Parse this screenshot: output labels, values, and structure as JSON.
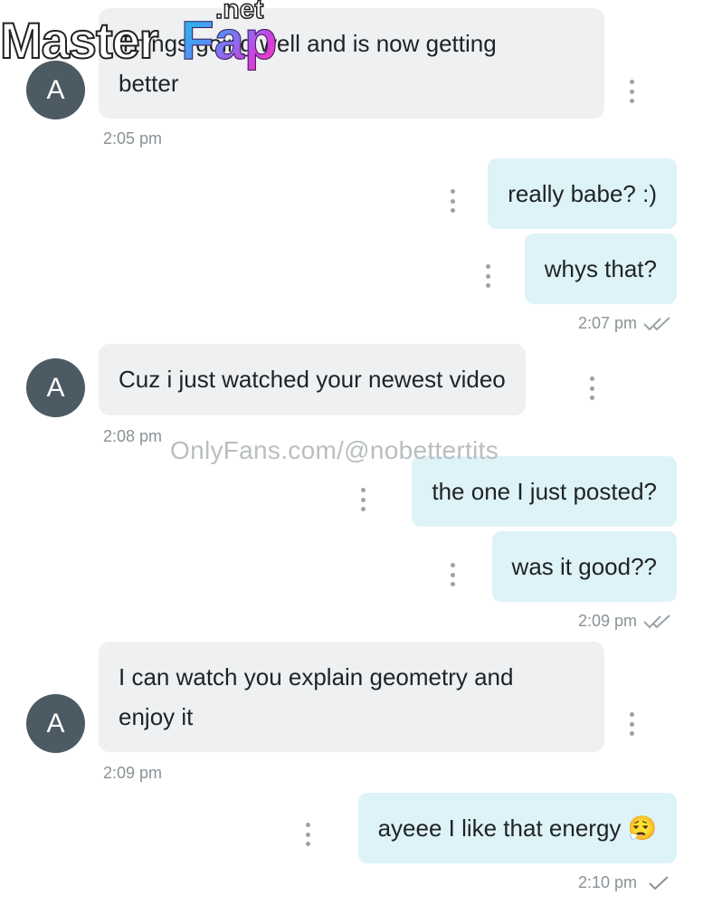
{
  "watermarks": {
    "site_main": "Master",
    "site_accent": "Fap",
    "site_tld": ".net",
    "onlyfans": "OnlyFans.com/@nobettertits"
  },
  "contact": {
    "avatar_initial": "A"
  },
  "messages": [
    {
      "direction": "in",
      "text": "Things going well and is now getting\nbetter",
      "time": "2:05 pm"
    },
    {
      "direction": "out",
      "text": "really babe? :)"
    },
    {
      "direction": "out",
      "text": "whys that?",
      "time": "2:07 pm",
      "status": "read"
    },
    {
      "direction": "in",
      "text": "Cuz i just watched your newest video",
      "time": "2:08 pm"
    },
    {
      "direction": "out",
      "text": "the one I just posted?"
    },
    {
      "direction": "out",
      "text": "was it good??",
      "time": "2:09 pm",
      "status": "read"
    },
    {
      "direction": "in",
      "text": "I can watch you explain geometry and\nenjoy it",
      "time": "2:09 pm"
    },
    {
      "direction": "out",
      "text": "ayeee I like that energy 😮‍💨",
      "time": "2:10 pm",
      "status": "sent"
    }
  ],
  "colors": {
    "incoming_bubble": "#eef0f1",
    "outgoing_bubble": "#ddf3f8",
    "avatar_bg": "#4b5a63",
    "timestamp": "#8a9296"
  },
  "icons": {
    "message_options": "more-vertical-icon",
    "read_status": "double-check-icon",
    "sent_status": "check-icon"
  }
}
